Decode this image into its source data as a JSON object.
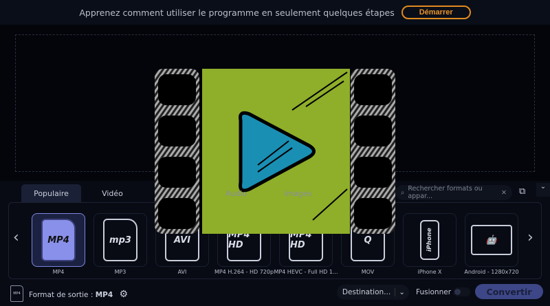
{
  "banner": {
    "message": "Apprenez comment utiliser le programme en seulement quelques étapes",
    "start_label": "Démarrer"
  },
  "dropzone": {
    "hint": "Faites glisser ici des fichiers et des dossiers"
  },
  "tabs": [
    {
      "label": "Populaire",
      "active": true
    },
    {
      "label": "Vidéo"
    },
    {
      "label": "Audio"
    },
    {
      "label": "Images"
    }
  ],
  "search": {
    "placeholder": "Rechercher formats ou appar..."
  },
  "formats": [
    {
      "label": "MP4",
      "icon": "MP4",
      "selected": true
    },
    {
      "label": "MP3",
      "icon": "mp3"
    },
    {
      "label": "AVI",
      "icon": "AVI"
    },
    {
      "label": "MP4 H.264 - HD 720p",
      "icon": "MP4 HD"
    },
    {
      "label": "MP4 HEVC - Full HD 1...",
      "icon": "MP4 HD"
    },
    {
      "label": "MOV",
      "icon": "Q"
    },
    {
      "label": "iPhone X",
      "icon": "iPhone"
    },
    {
      "label": "Android - 1280x720",
      "icon": "android"
    }
  ],
  "footer": {
    "format_label": "Format de sortie :",
    "format_value": "MP4",
    "format_icon_text": "MP4",
    "destination": "Destination...",
    "merge_label": "Fusionner :",
    "merge_on": false,
    "convert_label": "Convertir"
  },
  "colors": {
    "accent": "#7d86e0",
    "start": "#e08a20",
    "convert": "#3d4787",
    "logo_green": "#8fae2a",
    "logo_blue": "#1a8fb4"
  }
}
